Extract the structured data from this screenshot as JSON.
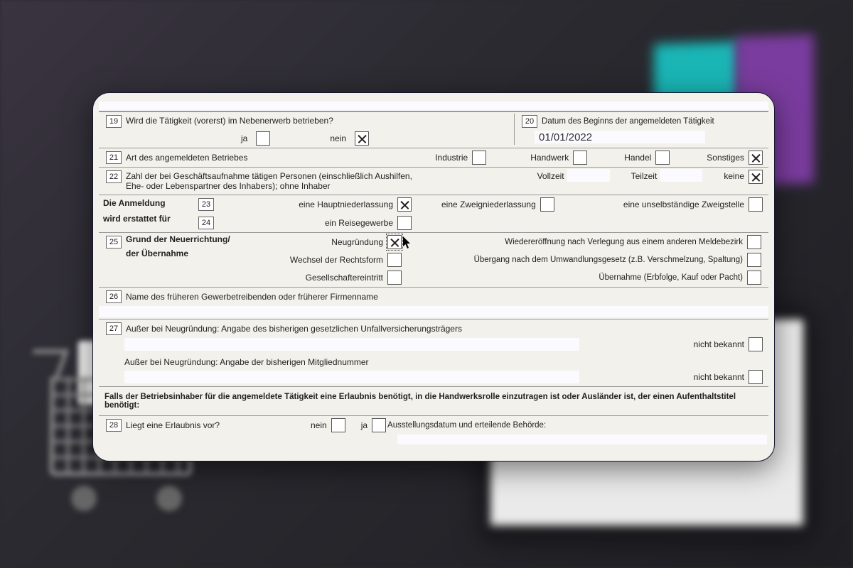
{
  "row19": {
    "num": "19",
    "q": "Wird die Tätigkeit (vorerst) im Nebenerwerb betrieben?",
    "ja": "ja",
    "nein": "nein"
  },
  "row20": {
    "num": "20",
    "q": "Datum des Beginns der angemeldeten Tätigkeit",
    "value": "01/01/2022"
  },
  "row21": {
    "num": "21",
    "q": "Art des angemeldeten Betriebes",
    "opt1": "Industrie",
    "opt2": "Handwerk",
    "opt3": "Handel",
    "opt4": "Sonstiges"
  },
  "row22": {
    "num": "22",
    "q": "Zahl der bei Geschäftsaufnahme tätigen Personen (einschließlich Aushilfen, Ehe- oder Lebenspartner des Inhabers); ohne Inhaber",
    "c1": "Vollzeit",
    "c2": "Teilzeit",
    "c3": "keine"
  },
  "anm": {
    "l1": "Die Anmeldung",
    "l2": "wird erstattet für"
  },
  "row23": {
    "num": "23",
    "a": "eine Hauptniederlassung",
    "b": "eine Zweigniederlassung",
    "c": "eine unselbständige Zweigstelle"
  },
  "row24": {
    "num": "24",
    "a": "ein Reisegewerbe"
  },
  "row25": {
    "num": "25",
    "title": "Grund der Neuerrichtung/",
    "title2": "der Übernahme",
    "a": "Neugründung",
    "b": "Wechsel der Rechtsform",
    "c": "Gesellschaftereintritt",
    "d": "Wiedereröffnung nach Verlegung aus einem anderen Meldebezirk",
    "e": "Übergang nach dem Umwandlungsgesetz (z.B. Verschmelzung, Spaltung)",
    "f": "Übernahme (Erbfolge, Kauf oder Pacht)"
  },
  "row26": {
    "num": "26",
    "q": "Name des früheren Gewerbetreibenden oder früherer Firmenname"
  },
  "row27": {
    "num": "27",
    "q1": "Außer bei Neugründung: Angabe des bisherigen gesetzlichen Unfallversicherungsträgers",
    "q2": "Außer bei Neugründung: Angabe der bisherigen Mitgliednummer",
    "nk": "nicht bekannt"
  },
  "sec": {
    "text": "Falls der Betriebsinhaber für die angemeldete Tätigkeit eine Erlaubnis benötigt, in die Handwerksrolle einzutragen ist oder Ausländer ist, der einen Aufenthaltstitel benötigt:"
  },
  "row28": {
    "num": "28",
    "q": "Liegt eine Erlaubnis vor?",
    "nein": "nein",
    "ja": "ja",
    "rest": "Ausstellungsdatum und erteilende Behörde:"
  }
}
